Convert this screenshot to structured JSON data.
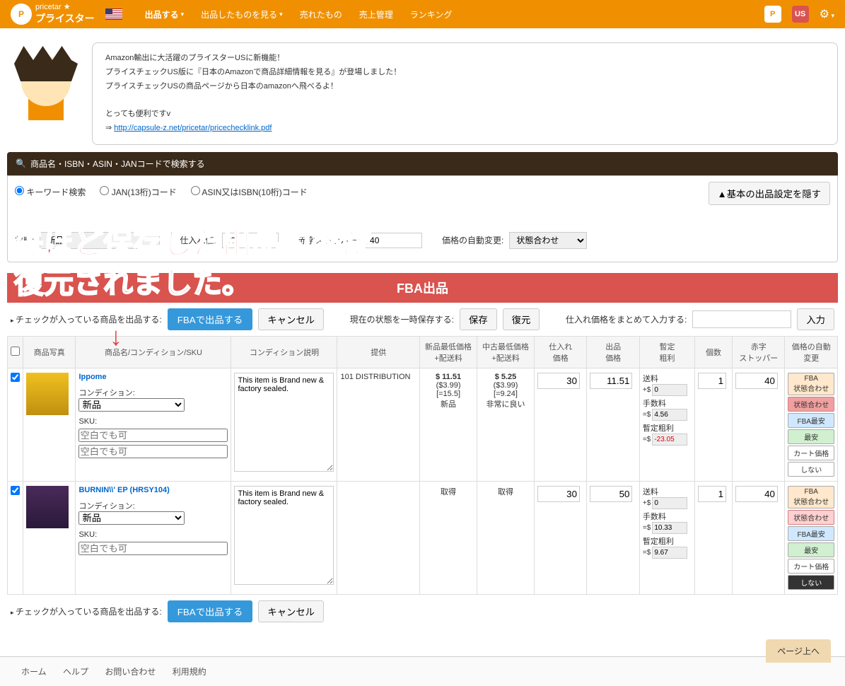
{
  "nav": {
    "logo_sub": "pricetar ★",
    "logo_main": "プライスター",
    "items": [
      "出品する",
      "出品したものを見る",
      "売れたもの",
      "売上管理",
      "ランキング"
    ],
    "us_badge": "US"
  },
  "bubble": {
    "l1": "Amazon輸出に大活躍のプライスターUSに新機能！",
    "l2": "プライスチェックUS版に『日本のAmazonで商品詳細情報を見る』が登場しました！",
    "l3": "プライスチェックUSの商品ページから日本のamazonへ飛べるよ！",
    "l4": "とっても便利ですv",
    "link_prefix": "⇒ ",
    "link": "http://capsule-z.net/pricetar/pricechecklink.pdf"
  },
  "search": {
    "label": "商品名・ISBN・ASIN・JANコードで検索する",
    "radios": [
      "キーワード検索",
      "JAN(13桁)コード",
      "ASIN又はISBN(10桁)コード"
    ],
    "hide_btn": "▲基本の出品設定を隠す",
    "status_lbl": "状態:",
    "status_val": "新品",
    "cost_lbl": "仕入れ値:",
    "cost_val": "30",
    "stopper_lbl": "赤字ストッパー:",
    "stopper_val": "40",
    "autoprice_lbl": "価格の自動変更:",
    "autoprice_val": "状態合わせ"
  },
  "overlay": {
    "line1": "先ほど保存した出品内容が",
    "line2": "復元されました。",
    "arrow": "↓"
  },
  "fba": {
    "header": "FBA出品",
    "check_lbl": "チェックが入っている商品を出品する:",
    "btn_submit": "FBAで出品する",
    "btn_cancel": "キャンセル",
    "save_lbl": "現在の状態を一時保存する:",
    "btn_save": "保存",
    "btn_restore": "復元",
    "bulk_lbl": "仕入れ価格をまとめて入力する:",
    "btn_input": "入力"
  },
  "table": {
    "headers": [
      "",
      "商品写真",
      "商品名/コンディション/SKU",
      "コンディション説明",
      "提供",
      "新品最低価格\n+配送料",
      "中古最低価格\n+配送料",
      "仕入れ\n価格",
      "出品\n価格",
      "暫定\n粗利",
      "個数",
      "赤字\nストッパー",
      "価格の自動\n変更"
    ],
    "cond_lbl": "コンディション:",
    "sku_lbl": "SKU:",
    "sku_ph": "空白でも可",
    "fee_ship": "送料",
    "fee_fee": "手数料",
    "fee_profit": "暫定粗利",
    "fee_prefix": "+$",
    "fee_prefix2": "=$",
    "auto_btns": [
      "FBA\n状態合わせ",
      "状態合わせ",
      "FBA最安",
      "最安",
      "カート価格",
      "しない"
    ]
  },
  "rows": [
    {
      "name": "Ippome",
      "cond": "新品",
      "desc": "This item is Brand new & factory sealed.",
      "provider": "101 DISTRIBUTION",
      "new_price": "$ 11.51",
      "new_ship": "($3.99)",
      "new_total": "[=15.5]",
      "new_cond": "新品",
      "used_price": "$ 5.25",
      "used_ship": "($3.99)",
      "used_total": "[=9.24]",
      "used_cond": "非常に良い",
      "cost": "30",
      "sell": "11.51",
      "ship_fee": "0",
      "hand_fee": "4.56",
      "profit": "-23.05",
      "qty": "1",
      "stopper": "40",
      "selected_auto": 1
    },
    {
      "name": "BURNIN\\\\' EP (HRSY104)",
      "cond": "新品",
      "desc": "This item is Brand new & factory sealed.",
      "provider": "",
      "new_price": "取得",
      "used_price": "取得",
      "cost": "30",
      "sell": "50",
      "ship_fee": "0",
      "hand_fee": "10.33",
      "profit": "9.67",
      "qty": "1",
      "stopper": "40",
      "selected_auto": 5
    }
  ],
  "footer": {
    "links": [
      "ホーム",
      "ヘルプ",
      "お問い合わせ",
      "利用規約"
    ],
    "pageup": "ページ上へ"
  }
}
